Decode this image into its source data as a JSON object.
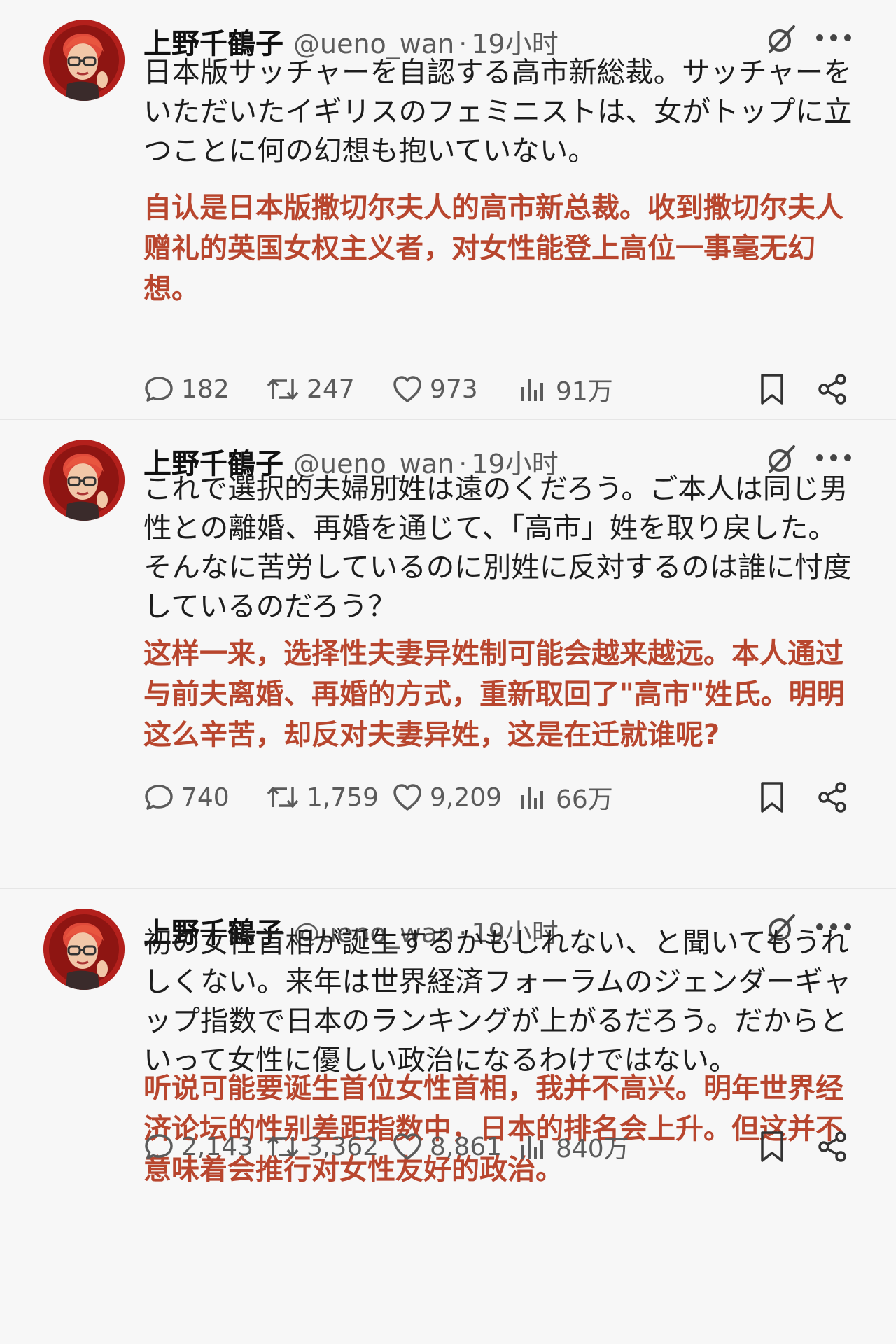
{
  "tweets": [
    {
      "author": "上野千鶴子",
      "handle": "@ueno_wan",
      "separator": "·",
      "time": "19小时",
      "text_jp": "日本版サッチャーを自認する高市新総裁。サッチャーをいただいたイギリスのフェミニストは、女がトップに立つことに何の幻想も抱いていない。",
      "text_cn": "自认是日本版撒切尔夫人的高市新总裁。收到撒切尔夫人赠礼的英国女权主义者，对女性能登上高位一事毫无幻想。",
      "replies": "182",
      "reposts": "247",
      "likes": "973",
      "views": "91万"
    },
    {
      "author": "上野千鶴子",
      "handle": "@ueno_wan",
      "separator": "·",
      "time": "19小时",
      "text_jp": "これで選択的夫婦別姓は遠のくだろう。ご本人は同じ男性との離婚、再婚を通じて、「高市」姓を取り戻した。そんなに苦労しているのに別姓に反対するのは誰に忖度しているのだろう？",
      "text_cn": "这样一来，选择性夫妻异姓制可能会越来越远。本人通过与前夫离婚、再婚的方式，重新取回了\"高市\"姓氏。明明这么辛苦，却反对夫妻异姓，这是在迁就谁呢?",
      "replies": "740",
      "reposts": "1,759",
      "likes": "9,209",
      "views": "66万"
    },
    {
      "author": "上野千鶴子",
      "handle": "@ueno_wan",
      "separator": "·",
      "time": "19小时",
      "text_jp": "初の女性首相が誕生するかもしれない、と聞いてもうれしくない。来年は世界経済フォーラムのジェンダーギャップ指数で日本のランキングが上がるだろう。だからといって女性に優しい政治になるわけではない。",
      "text_cn": "听说可能要诞生首位女性首相，我并不高兴。明年世界经济论坛的性别差距指数中，日本的排名会上升。但这并不意味着会推行对女性友好的政治。",
      "replies": "2,143",
      "reposts": "3,362",
      "likes": "8,861",
      "views": "840万"
    }
  ],
  "colors": {
    "translation_text": "#b8462e",
    "icon_gray": "#5b5b5b",
    "avatar_bg": "#b3201c"
  },
  "icons": {
    "reply": "speech-bubble",
    "repost": "retweet-arrows",
    "like": "heart",
    "views": "bar-chart",
    "bookmark": "bookmark",
    "share": "share-nodes",
    "grok": "grok-slash-circle",
    "more": "ellipsis"
  }
}
